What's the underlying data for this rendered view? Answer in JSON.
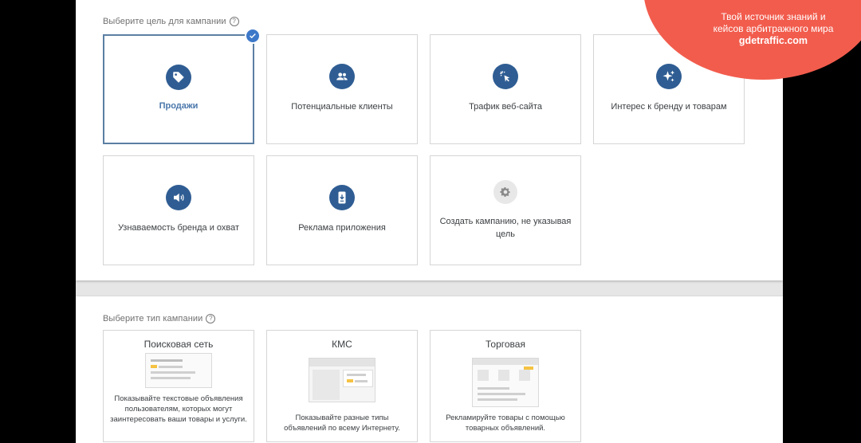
{
  "goals_section": {
    "title": "Выберите цель для кампании",
    "help": "?",
    "cards": [
      {
        "label": "Продажи",
        "icon": "tag-icon",
        "selected": true
      },
      {
        "label": "Потенциальные клиенты",
        "icon": "people-icon",
        "selected": false
      },
      {
        "label": "Трафик веб-сайта",
        "icon": "cursor-click-icon",
        "selected": false
      },
      {
        "label": "Интерес к бренду и товарам",
        "icon": "sparkle-icon",
        "selected": false
      },
      {
        "label": "Узнаваемость бренда и охват",
        "icon": "speaker-icon",
        "selected": false
      },
      {
        "label": "Реклама приложения",
        "icon": "phone-download-icon",
        "selected": false
      },
      {
        "label": "Создать кампанию, не указывая цель",
        "icon": "gear-icon",
        "selected": false
      }
    ]
  },
  "types_section": {
    "title": "Выберите тип кампании",
    "help": "?",
    "cards": [
      {
        "label": "Поисковая сеть",
        "desc": "Показывайте текстовые объявления пользователям, которых могут заинтересовать ваши товары и услуги."
      },
      {
        "label": "КМС",
        "desc": "Показывайте разные типы объявлений по всему Интернету."
      },
      {
        "label": "Торговая",
        "desc": "Рекламируйте товары с помощью товарных объявлений."
      }
    ]
  },
  "watermark": {
    "line1": "Твой источник знаний и",
    "line2": "кейсов арбитражного мира",
    "brand": "gdetraffic.com"
  },
  "colors": {
    "accent": "#2f5d93",
    "selected_border": "#5b7fa3",
    "check": "#3d78c9",
    "watermark": "#f25c4d"
  }
}
